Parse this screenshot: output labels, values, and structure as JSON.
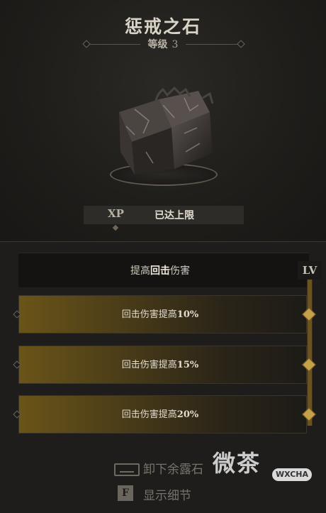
{
  "item": {
    "name": "惩戒之石",
    "level_label": "等级",
    "level_value": "3"
  },
  "xp": {
    "label": "XP",
    "value": "已达上限"
  },
  "skill": {
    "header_prefix": "提高",
    "header_bold": "回击",
    "header_suffix": "伤害",
    "lv_badge": "LV",
    "ranks": [
      {
        "text": "回击伤害提高",
        "pct": "10%"
      },
      {
        "text": "回击伤害提高",
        "pct": "15%"
      },
      {
        "text": "回击伤害提高",
        "pct": "20%"
      }
    ]
  },
  "actions": {
    "unequip_label": "卸下余露石",
    "details_key": "F",
    "details_label": "显示细节"
  },
  "watermark": {
    "text": "微茶",
    "badge": "WXCHA"
  },
  "colors": {
    "accent_gold": "#c6a14a",
    "background": "#1c1b19"
  }
}
